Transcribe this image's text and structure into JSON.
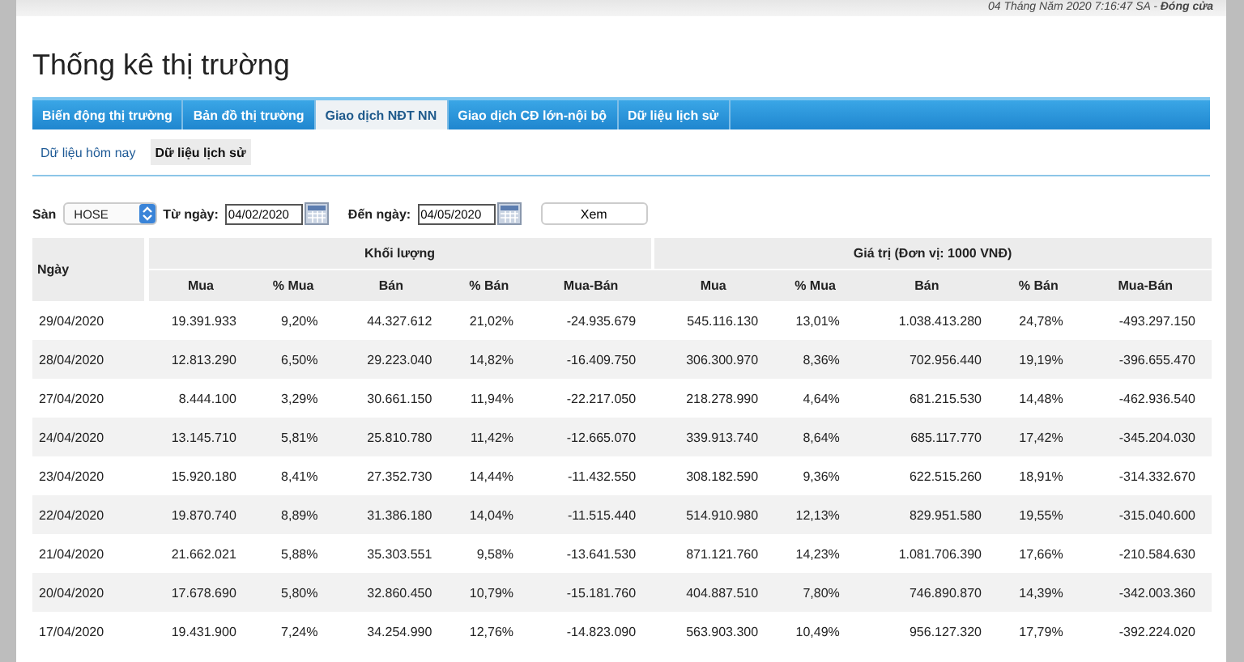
{
  "status_bar": {
    "text": "04 Tháng Năm 2020 7:16:47 SA - **Đóng cửa**"
  },
  "title": "Thống kê thị trường",
  "tabs": [
    {
      "label": "Biến động thị trường",
      "selected": false
    },
    {
      "label": "Bản đồ thị trường",
      "selected": false
    },
    {
      "label": "Giao dịch NĐT NN",
      "selected": true
    },
    {
      "label": "Giao dịch CĐ lớn-nội bộ",
      "selected": false
    },
    {
      "label": "Dữ liệu lịch sử",
      "selected": false
    }
  ],
  "subtabs": [
    {
      "label": "Dữ liệu hôm nay",
      "selected": false
    },
    {
      "label": "Dữ liệu lịch sử",
      "selected": true
    }
  ],
  "filters": {
    "exchange_label": "Sàn",
    "exchange_value": "HOSE",
    "from_label": "Từ ngày:",
    "from_value": "04/02/2020",
    "to_label": "Đến ngày:",
    "to_value": "04/05/2020",
    "button": "Xem"
  },
  "table": {
    "date_header": "Ngày",
    "groups": [
      {
        "label": "Khối lượng",
        "columns": [
          "Mua",
          "% Mua",
          "Bán",
          "% Bán",
          "Mua-Bán"
        ]
      },
      {
        "label": "Giá trị (Đơn vị: 1000 VNĐ)",
        "columns": [
          "Mua",
          "% Mua",
          "Bán",
          "% Bán",
          "Mua-Bán"
        ]
      }
    ],
    "rows": [
      [
        "29/04/2020",
        "19.391.933",
        "9,20%",
        "44.327.612",
        "21,02%",
        "-24.935.679",
        "545.116.130",
        "13,01%",
        "1.038.413.280",
        "24,78%",
        "-493.297.150"
      ],
      [
        "28/04/2020",
        "12.813.290",
        "6,50%",
        "29.223.040",
        "14,82%",
        "-16.409.750",
        "306.300.970",
        "8,36%",
        "702.956.440",
        "19,19%",
        "-396.655.470"
      ],
      [
        "27/04/2020",
        "8.444.100",
        "3,29%",
        "30.661.150",
        "11,94%",
        "-22.217.050",
        "218.278.990",
        "4,64%",
        "681.215.530",
        "14,48%",
        "-462.936.540"
      ],
      [
        "24/04/2020",
        "13.145.710",
        "5,81%",
        "25.810.780",
        "11,42%",
        "-12.665.070",
        "339.913.740",
        "8,64%",
        "685.117.770",
        "17,42%",
        "-345.204.030"
      ],
      [
        "23/04/2020",
        "15.920.180",
        "8,41%",
        "27.352.730",
        "14,44%",
        "-11.432.550",
        "308.182.590",
        "9,36%",
        "622.515.260",
        "18,91%",
        "-314.332.670"
      ],
      [
        "22/04/2020",
        "19.870.740",
        "8,89%",
        "31.386.180",
        "14,04%",
        "-11.515.440",
        "514.910.980",
        "12,13%",
        "829.951.580",
        "19,55%",
        "-315.040.600"
      ],
      [
        "21/04/2020",
        "21.662.021",
        "5,88%",
        "35.303.551",
        "9,58%",
        "-13.641.530",
        "871.121.760",
        "14,23%",
        "1.081.706.390",
        "17,66%",
        "-210.584.630"
      ],
      [
        "20/04/2020",
        "17.678.690",
        "5,80%",
        "32.860.450",
        "10,79%",
        "-15.181.760",
        "404.887.510",
        "7,80%",
        "746.890.870",
        "14,39%",
        "-342.003.360"
      ],
      [
        "17/04/2020",
        "19.431.900",
        "7,24%",
        "34.254.990",
        "12,76%",
        "-14.823.090",
        "563.903.300",
        "10,49%",
        "956.127.320",
        "17,79%",
        "-392.224.020"
      ]
    ]
  }
}
